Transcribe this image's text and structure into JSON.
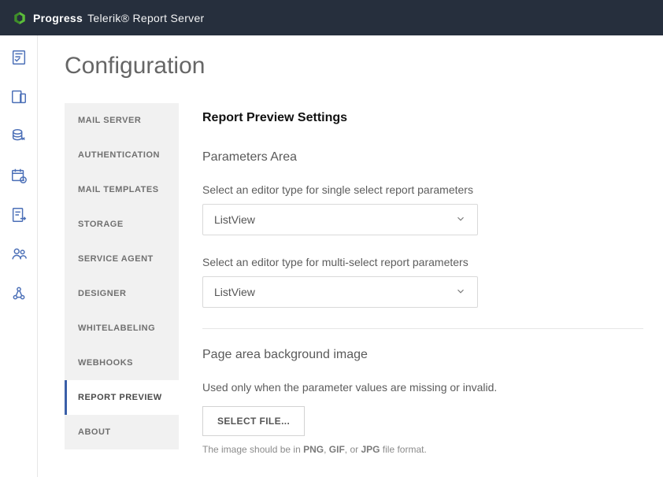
{
  "brand": {
    "progress": "Progress",
    "rest": "Telerik® Report Server"
  },
  "page": {
    "title": "Configuration"
  },
  "tabs": [
    {
      "label": "MAIL SERVER"
    },
    {
      "label": "AUTHENTICATION"
    },
    {
      "label": "MAIL TEMPLATES"
    },
    {
      "label": "STORAGE"
    },
    {
      "label": "SERVICE AGENT"
    },
    {
      "label": "DESIGNER"
    },
    {
      "label": "WHITELABELING"
    },
    {
      "label": "WEBHOOKS"
    },
    {
      "label": "REPORT PREVIEW"
    },
    {
      "label": "ABOUT"
    }
  ],
  "panel": {
    "title": "Report Preview Settings",
    "params_area_heading": "Parameters Area",
    "single_label": "Select an editor type for single select report parameters",
    "single_value": "ListView",
    "multi_label": "Select an editor type for multi-select report parameters",
    "multi_value": "ListView",
    "bg_heading": "Page area background image",
    "bg_hint": "Used only when the parameter values are missing or invalid.",
    "select_file_btn": "SELECT FILE...",
    "format_hint_prefix": "The image should be in ",
    "format_png": "PNG",
    "format_gif": "GIF",
    "format_jpg": "JPG",
    "format_hint_mid1": ", ",
    "format_hint_mid2": ", or ",
    "format_hint_suffix": " file format."
  }
}
